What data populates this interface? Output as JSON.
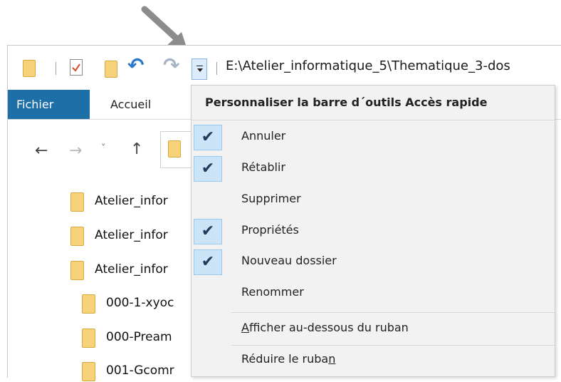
{
  "qat": {
    "path": "E:\\Atelier_informatique_5\\Thematique_3-dos",
    "icons": [
      "folder-icon",
      "properties-icon",
      "new-folder-icon",
      "undo-icon",
      "redo-icon",
      "customize-dropdown-icon"
    ]
  },
  "ribbon": {
    "tabs": [
      {
        "label": "Fichier",
        "active": true
      },
      {
        "label": "Accueil",
        "active": false
      }
    ],
    "accent": "#1e6ea8"
  },
  "nav": {
    "back": "←",
    "forward": "→",
    "recent": "˅",
    "up": "↑"
  },
  "tree": {
    "items": [
      {
        "label": "Atelier_infor"
      },
      {
        "label": "Atelier_infor"
      },
      {
        "label": "Atelier_infor"
      },
      {
        "label": "000-1-xyoc"
      },
      {
        "label": "000-Pream"
      },
      {
        "label": "001-Gcomr"
      }
    ]
  },
  "menu": {
    "title": "Personnaliser la barre d´outils Accès rapide",
    "items": [
      {
        "label": "Annuler",
        "checked": true
      },
      {
        "label": "Rétablir",
        "checked": true
      },
      {
        "label": "Supprimer",
        "checked": false
      },
      {
        "label": "Propriétés",
        "checked": true
      },
      {
        "label": "Nouveau dossier",
        "checked": true
      },
      {
        "label": "Renommer",
        "checked": false
      },
      {
        "label_underlined": "A",
        "label_rest": "fficher au-dessous du ruban",
        "checked": false
      },
      {
        "label_start": "Réduire le ruba",
        "label_underlined": "n",
        "checked": false
      }
    ],
    "check_glyph": "✔"
  }
}
